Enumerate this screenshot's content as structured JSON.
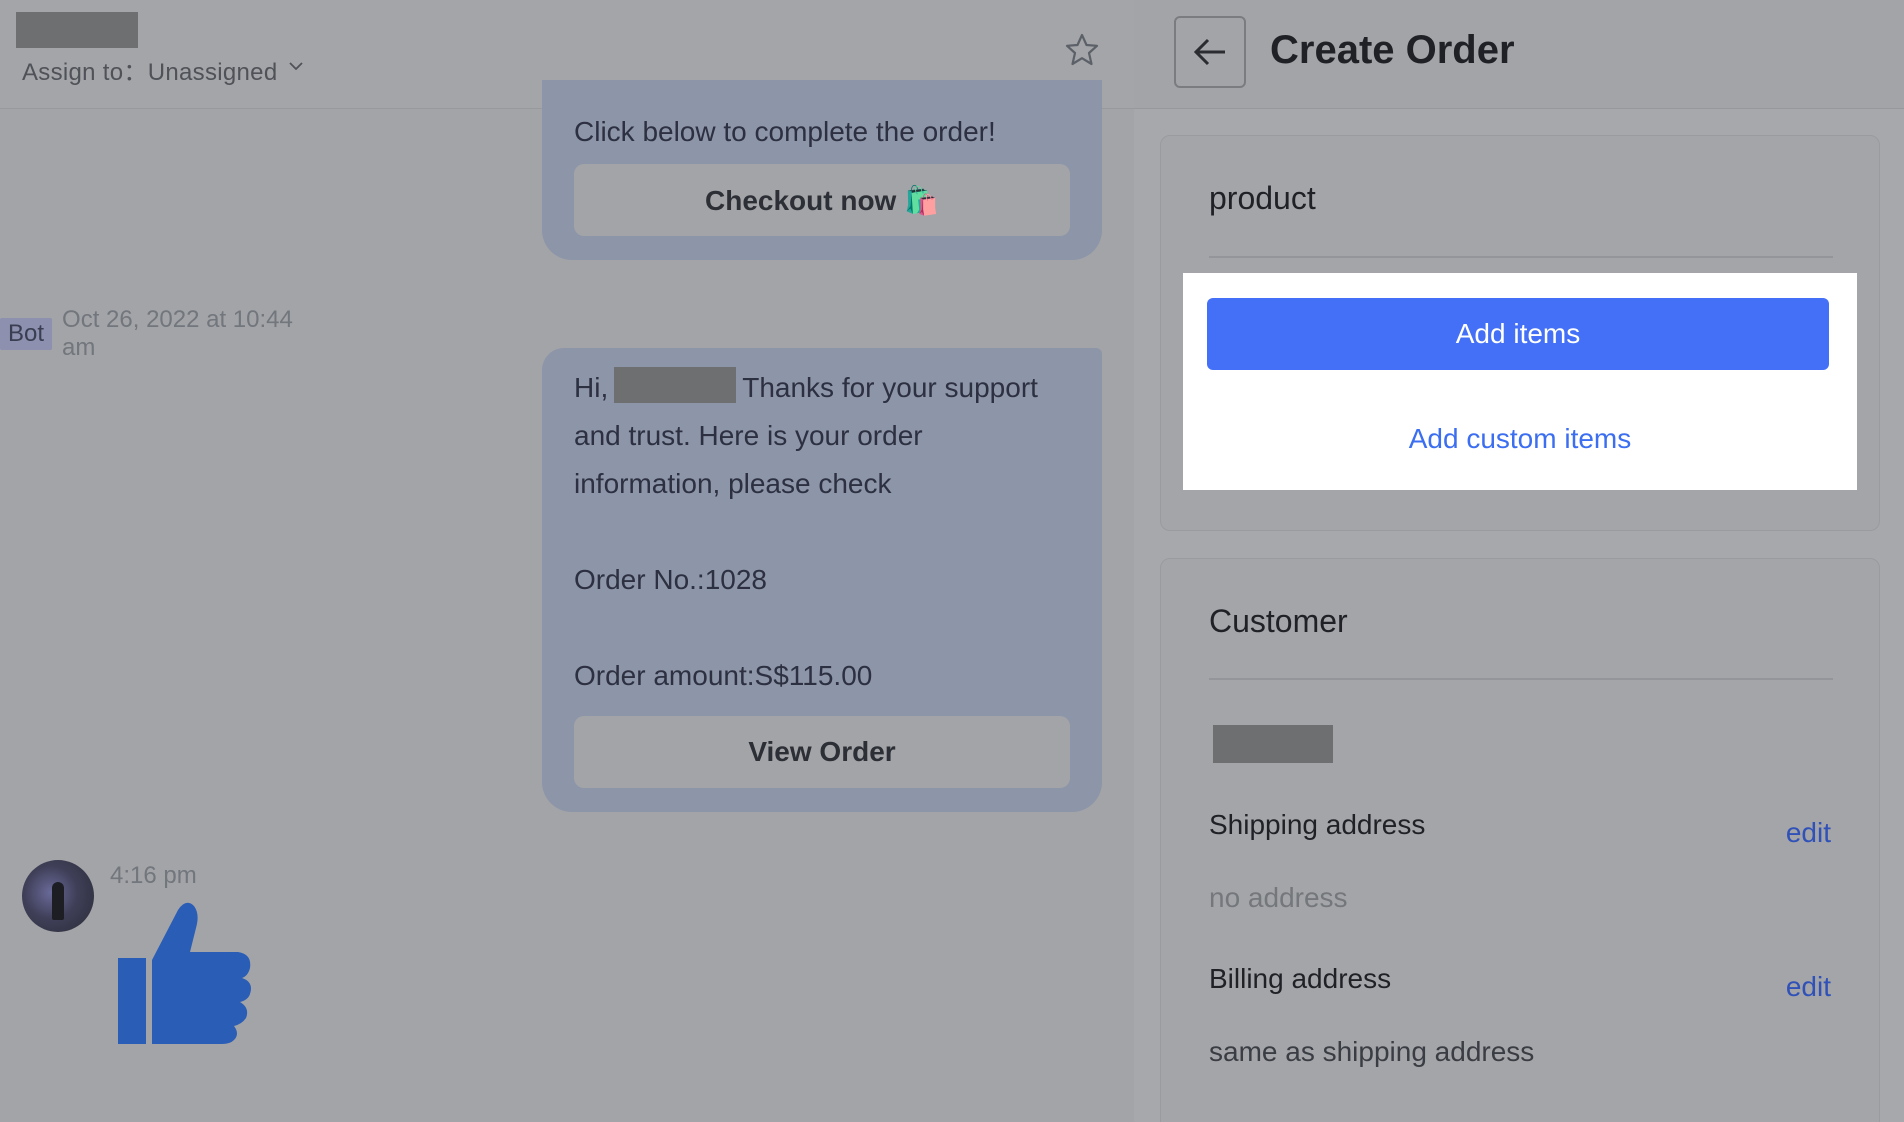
{
  "chat": {
    "assign_label": "Assign to：Unassigned",
    "bubble1_text": "Click below to complete the order!",
    "checkout_button": "Checkout now 🛍️",
    "bot_tag": "Bot",
    "bot_timestamp": "Oct 26, 2022 at 10:44 am",
    "bubble2_greeting": "Hi,",
    "bubble2_line1_rest": "Thanks for your support",
    "bubble2_line2": "and trust. Here is your order",
    "bubble2_line3": "information, please check",
    "order_no": "Order No.:1028",
    "order_amount": "Order amount:S$115.00",
    "view_order_button": "View Order",
    "incoming_time": "4:16 pm",
    "colors": {
      "bubble": "#8d95a8",
      "thumb": "#2a5db5"
    }
  },
  "order": {
    "title": "Create Order",
    "product_title": "product",
    "add_items_button": "Add items",
    "add_custom_items_link": "Add custom items",
    "customer_title": "Customer",
    "shipping_label": "Shipping address",
    "shipping_edit": "edit",
    "shipping_value": "no address",
    "billing_label": "Billing address",
    "billing_edit": "edit",
    "billing_value": "same as shipping address",
    "colors": {
      "primary": "#4370f6",
      "link": "#3b6ef0"
    }
  }
}
